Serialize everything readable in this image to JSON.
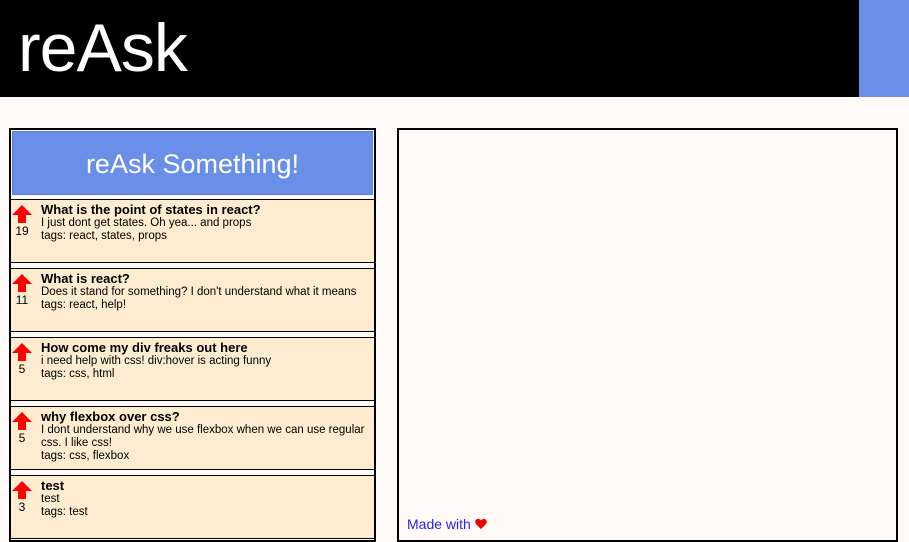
{
  "header": {
    "logo": "reAsk"
  },
  "ask_button": {
    "label": "reAsk Something!"
  },
  "questions": [
    {
      "votes": "19",
      "title": "What is the point of states in react?",
      "body": "I just dont get states. Oh yea... and props",
      "tags": "tags: react, states, props"
    },
    {
      "votes": "11",
      "title": "What is react?",
      "body": "Does it stand for something? I don't understand what it means",
      "tags": "tags: react, help!"
    },
    {
      "votes": "5",
      "title": "How come my div freaks out here",
      "body": "i need help with css! div:hover is acting funny",
      "tags": "tags: css, html"
    },
    {
      "votes": "5",
      "title": "why flexbox over css?",
      "body": "I dont understand why we use flexbox when we can use regular css. I like css!",
      "tags": "tags: css, flexbox"
    },
    {
      "votes": "3",
      "title": "test",
      "body": "test",
      "tags": "tags: test"
    }
  ],
  "footer": {
    "made_with": "Made with"
  },
  "icons": {
    "upvote": "arrow-up-icon",
    "heart": "heart-icon"
  },
  "colors": {
    "header_bg": "#000000",
    "accent_blue": "#6a8fe8",
    "question_bg": "#fdecd0",
    "upvote_red": "#ff0000",
    "link_blue": "#2a1ff0"
  }
}
